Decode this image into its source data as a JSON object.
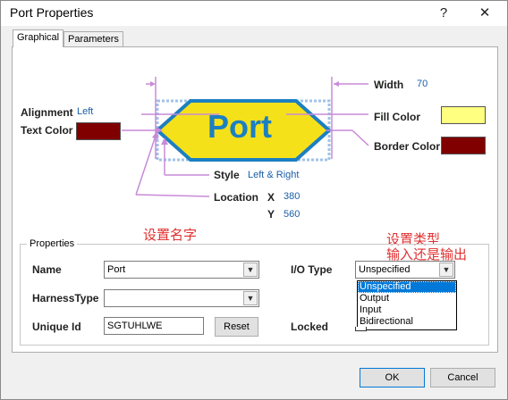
{
  "window": {
    "title": "Port Properties",
    "help_glyph": "?",
    "close_glyph": "✕"
  },
  "tabs": [
    "Graphical",
    "Parameters"
  ],
  "graphic": {
    "port_text": "Port",
    "width_label": "Width",
    "width_value": "70",
    "alignment_label": "Alignment",
    "alignment_value": "Left",
    "text_color_label": "Text Color",
    "text_color": "#800000",
    "fill_color_label": "Fill Color",
    "fill_color": "#ffff80",
    "border_color_label": "Border Color",
    "border_color": "#800000",
    "style_label": "Style",
    "style_value": "Left & Right",
    "location_label": "Location",
    "x_label": "X",
    "x_value": "380",
    "y_label": "Y",
    "y_value": "560",
    "port_fill": "#f5e11a",
    "port_border": "#1c7fc2",
    "guide_color": "#c88ad8"
  },
  "annotations": {
    "set_name": "设置名字",
    "set_type": "设置类型",
    "in_or_out": "输入还是输出"
  },
  "properties": {
    "group_title": "Properties",
    "name_label": "Name",
    "name_value": "Port",
    "harness_label": "HarnessType",
    "harness_value": "",
    "unique_id_label": "Unique Id",
    "unique_id_value": "SGTUHLWE",
    "reset_label": "Reset",
    "io_type_label": "I/O Type",
    "io_type_value": "Unspecified",
    "io_options": [
      "Unspecified",
      "Output",
      "Input",
      "Bidirectional"
    ],
    "locked_label": "Locked"
  },
  "footer": {
    "ok_label": "OK",
    "cancel_label": "Cancel"
  }
}
